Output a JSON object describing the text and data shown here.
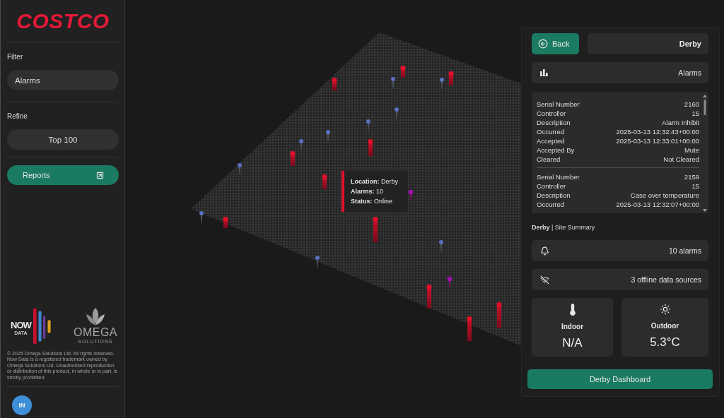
{
  "sidebar": {
    "logo": "COSTCO",
    "filter": {
      "label": "Filter",
      "value": "Alarms"
    },
    "refine": {
      "label": "Refine",
      "value": "Top 100"
    },
    "reports_button": "Reports",
    "partner_logos": [
      {
        "kind": "now_data",
        "wordmark": "NOW",
        "tagline": "DATA"
      },
      {
        "kind": "omega",
        "wordmark": "OMEGA",
        "tagline": "SOLUTIONS"
      }
    ],
    "copyright": "© 2025 Omega Solutions Ltd. All rights reserved. Now Data is a registered trademark owned by Omega Solutions Ltd. Unauthorised reproduction or distribution of this product, in whole or in part, is strictly prohibited.",
    "user_avatar": "IN"
  },
  "map": {
    "tooltip": [
      "**Location:** Derby",
      "**Alarms:** 10",
      "**Status:** Online"
    ]
  },
  "site_panel": {
    "back_button": "Back",
    "site_name": "Derby",
    "alarms_header": "Alarms",
    "alarms": [
      {
        "fields": [
          {
            "label": "Serial Number",
            "value": "2160"
          },
          {
            "label": "Controller",
            "value": "15"
          },
          {
            "label": "Description",
            "value": "Alarm Inhibit"
          },
          {
            "label": "Occurred",
            "value": "2025-03-13 12:32:43+00:00"
          },
          {
            "label": "Accepted",
            "value": "2025-03-13 12:33:01+00:00"
          },
          {
            "label": "Accepted By",
            "value": "Mute"
          },
          {
            "label": "Cleared",
            "value": "Not Cleared"
          }
        ]
      },
      {
        "fields": [
          {
            "label": "Serial Number",
            "value": "2159"
          },
          {
            "label": "Controller",
            "value": "15"
          },
          {
            "label": "Description",
            "value": "Case over temperature"
          },
          {
            "label": "Occurred",
            "value": "2025-03-13 12:32:07+00:00"
          }
        ]
      }
    ],
    "summary_title": "**Derby** | Site Summary",
    "summary_rows": [
      {
        "kind": "alarms",
        "text": "10 alarms"
      },
      {
        "kind": "offline",
        "text": "3 offline data sources"
      }
    ],
    "temperatures": [
      {
        "kind": "indoor",
        "label": "Indoor",
        "value": "N/A"
      },
      {
        "kind": "outdoor",
        "label": "Outdoor",
        "value": "5.3°C"
      }
    ],
    "dashboard_button": "Derby Dashboard"
  }
}
